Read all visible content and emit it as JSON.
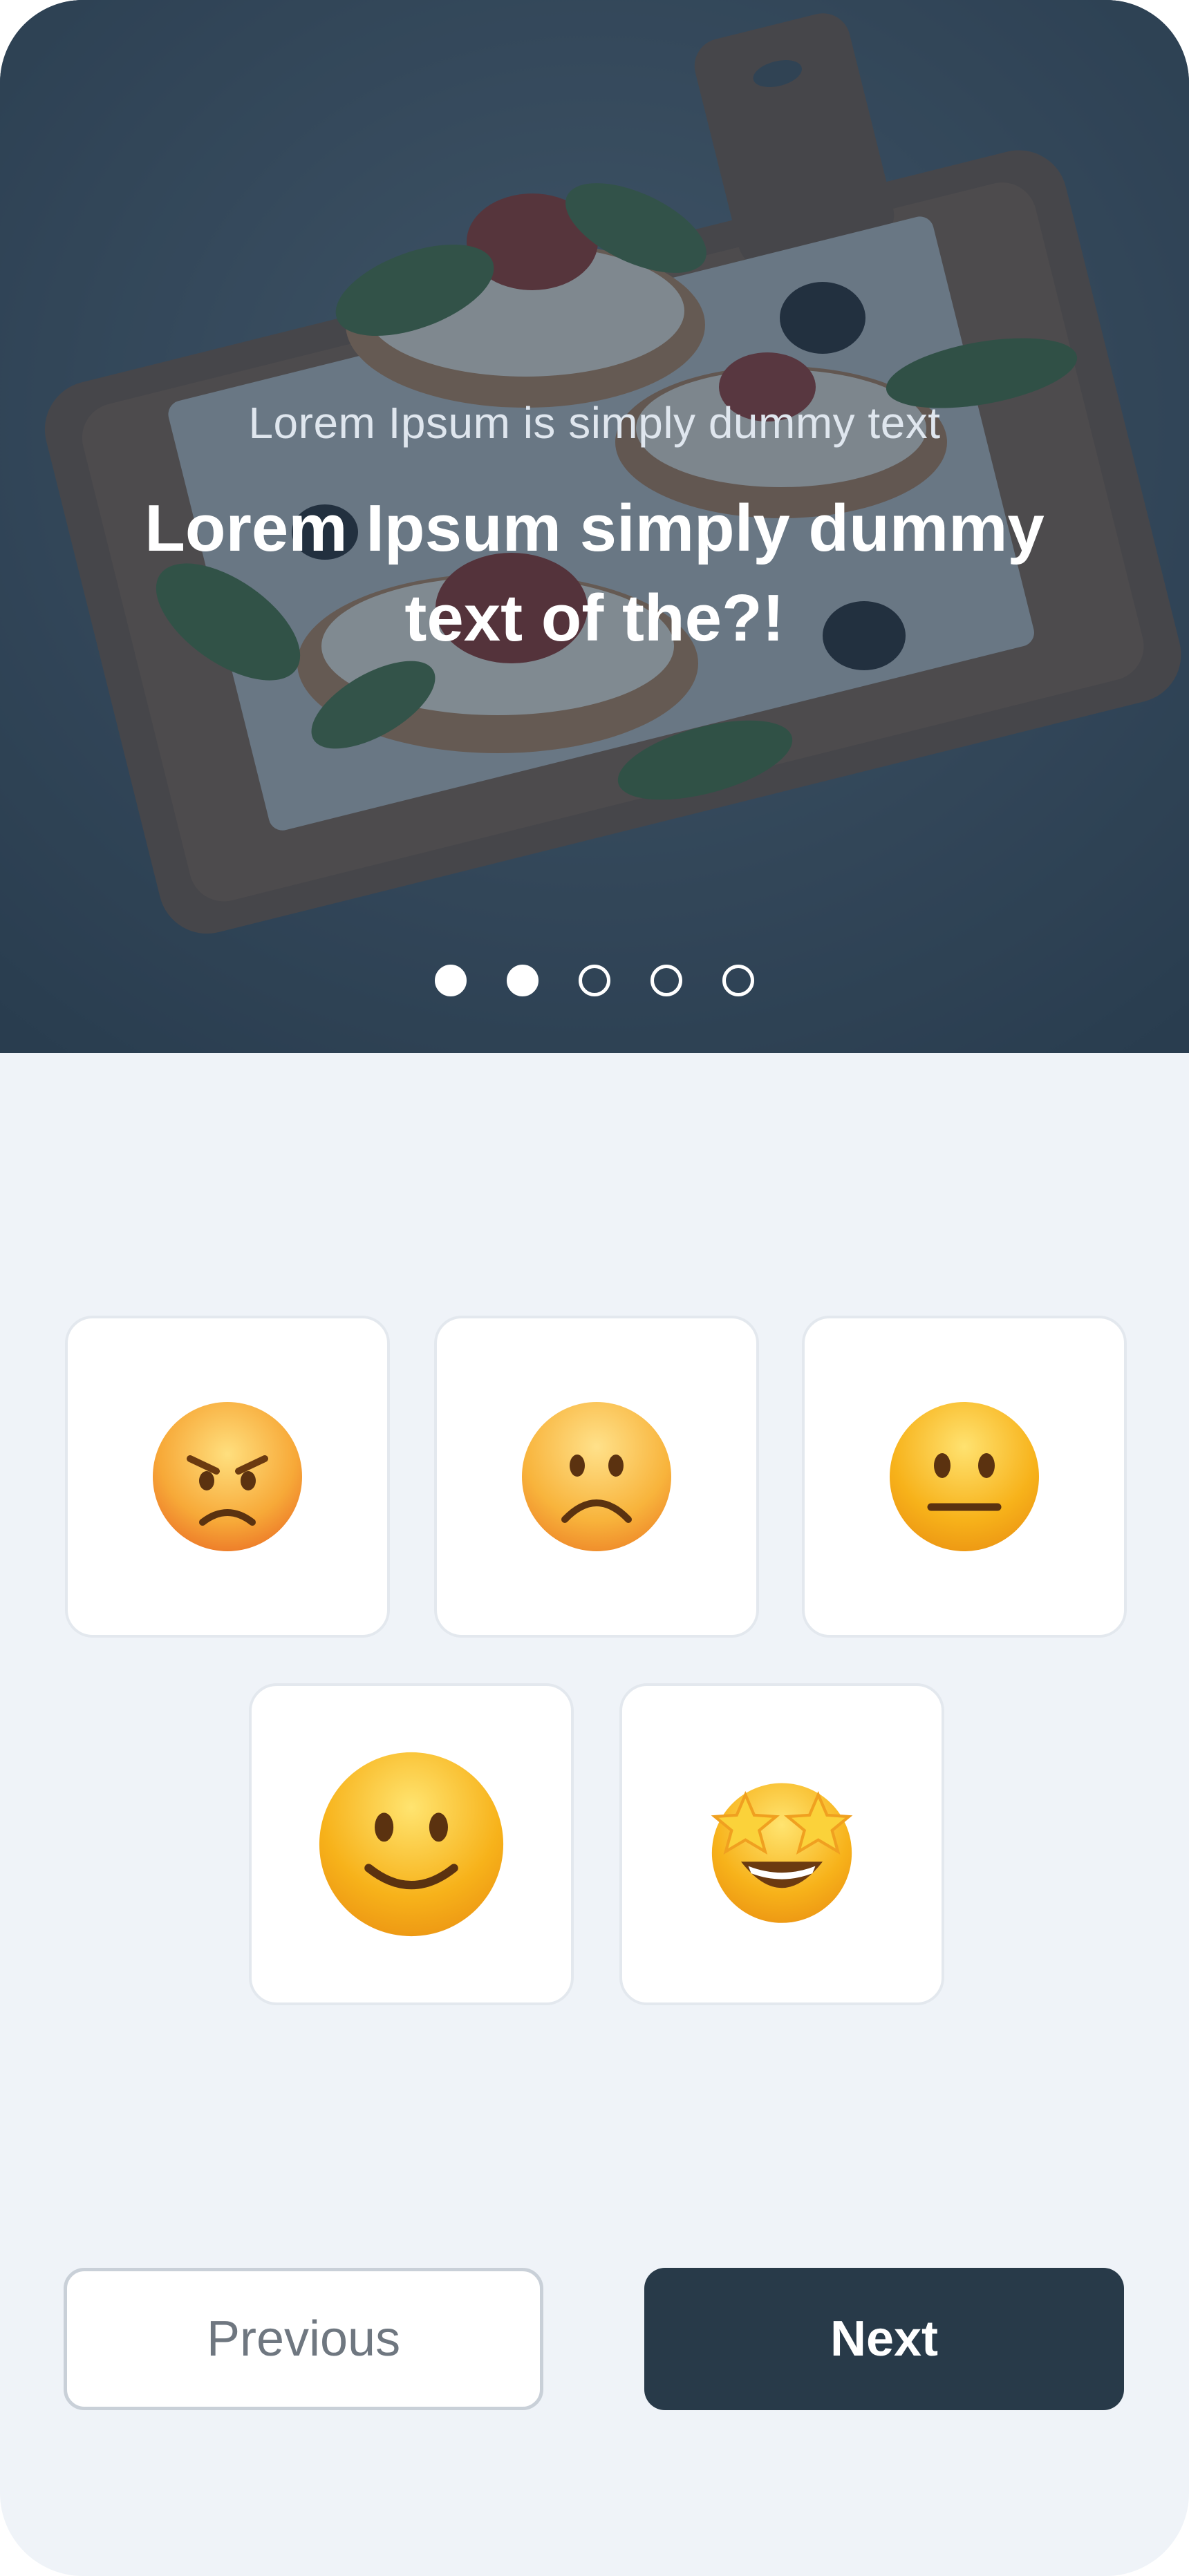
{
  "hero": {
    "subtitle": "Lorem Ipsum is simply dummy text",
    "title": "Lorem Ipsum simply dummy text of the?!",
    "image_icon": "food-board-photo",
    "pager": {
      "total": 5,
      "filled": [
        true,
        true,
        false,
        false,
        false
      ]
    }
  },
  "ratings": [
    {
      "icon": "angry-face-icon"
    },
    {
      "icon": "frowning-face-icon"
    },
    {
      "icon": "neutral-face-icon"
    },
    {
      "icon": "slightly-smiling-face-icon"
    },
    {
      "icon": "star-struck-face-icon"
    }
  ],
  "buttons": {
    "previous_label": "Previous",
    "next_label": "Next"
  },
  "colors": {
    "background": "#eff3f8",
    "primary": "#283a49",
    "overlay": "#34495c",
    "card_border": "#e3e8ee",
    "emoji_yellow": "#f7b21a"
  }
}
